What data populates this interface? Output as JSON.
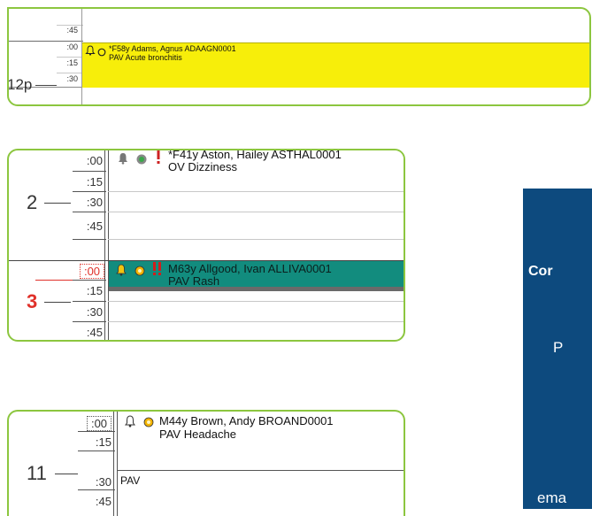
{
  "card1": {
    "slots": [
      ":45",
      ":00",
      ":15",
      ":30"
    ],
    "hour_label": "12p",
    "appointment": {
      "line1": "*F58y Adams, Agnus  ADAAGN0001",
      "line2": "PAV  Acute bronchitis",
      "color": "#f7ee0a"
    }
  },
  "card2": {
    "slots_top": [
      ":00",
      ":15",
      ":30",
      ":45"
    ],
    "slots_bottom": [
      ":00",
      ":15",
      ":30",
      ":45"
    ],
    "hour_label_top": "2",
    "hour_label_bottom": "3",
    "appointment_top": {
      "line1": "*F41y  Aston, Hailey  ASTHAL0001",
      "line2": "OV  Dizziness"
    },
    "appointment_bottom": {
      "line1": "M63y  Allgood, Ivan  ALLIVA0001",
      "line2": "PAV  Rash",
      "color": "#128c7e"
    }
  },
  "card3": {
    "slots": [
      ":00",
      ":15",
      ":30",
      ":45"
    ],
    "hour_label": "11",
    "appointment": {
      "line1": "M44y  Brown, Andy  BROAND0001",
      "line2": "PAV  Headache"
    },
    "second_entry": "PAV"
  },
  "side_panel": {
    "line1": "Cor",
    "line2": "P",
    "line3": "ema",
    "color": "#0d4a7e"
  },
  "colors": {
    "card_border": "#8cc63f",
    "hour_red": "#e0312a",
    "bell_yellow": "#f2c40f",
    "circle_orange": "#f4b400",
    "gray_circle_green": "#3aa84a"
  },
  "icons": [
    "bell-icon",
    "circle-status-icon",
    "exclamation-icon",
    "double-exclamation-icon"
  ]
}
